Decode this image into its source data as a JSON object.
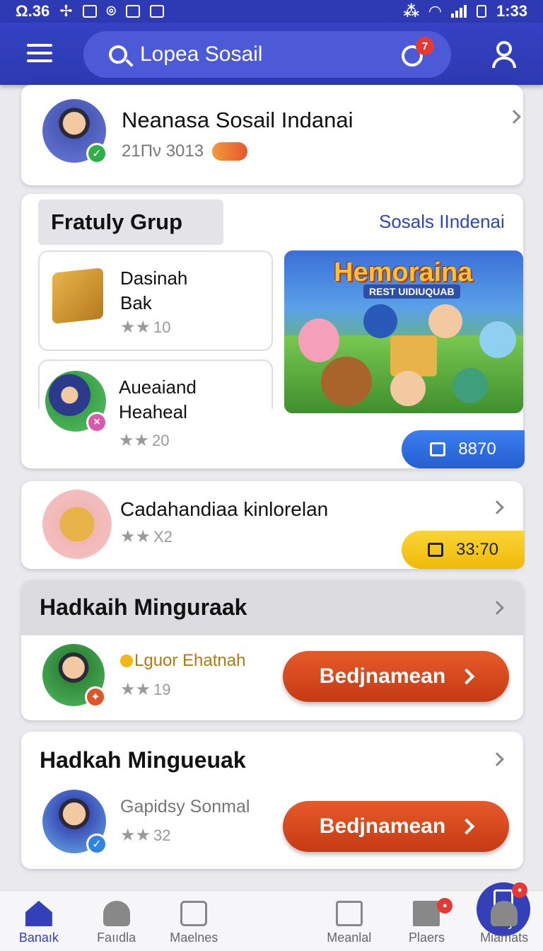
{
  "status_bar": {
    "left_text": "Ω.36",
    "time": "1:33"
  },
  "app_bar": {
    "search_text": "Lopea Sosail",
    "notification_count": "7"
  },
  "profile_card": {
    "name": "Neanasa Sosail Indanai",
    "subtitle": "21Πν 3013"
  },
  "featured": {
    "title": "Fratuly Grup",
    "link": "Sosals IIndenai",
    "items": [
      {
        "name_line1": "Dasinah",
        "name_line2": "Bak",
        "rating": "10"
      },
      {
        "name_line1": "Aueaiand",
        "name_line2": "Heaheal",
        "rating": "20"
      }
    ],
    "banner_title": "Hemoraina",
    "banner_subtitle": "REST UIDIUQUAB",
    "price": "8870"
  },
  "row_card": {
    "name": "Cadahandiaa kinlorelan",
    "rating": "X2",
    "price": "33:70"
  },
  "section1": {
    "title": "Hadkaih Minguraak",
    "person": "Lguor Ehatnah",
    "rating": "19",
    "button": "Bedjnamean"
  },
  "section2": {
    "title": "Hadkah Mingueuak",
    "person": "Gapidsy Sonmal",
    "rating": "32",
    "button": "Bedjnamean"
  },
  "bottom_nav": [
    {
      "label": "Banaık"
    },
    {
      "label": "Faııdla"
    },
    {
      "label": "Maelnes"
    },
    {
      "label": "Boy"
    },
    {
      "label": "Meanlal"
    },
    {
      "label": "Plaers"
    },
    {
      "label": "Miamats"
    }
  ],
  "colors": {
    "primary": "#2e3ab3",
    "accent": "#d4451d",
    "price_blue": "#2f6fe0",
    "price_yellow": "#f6c416"
  }
}
